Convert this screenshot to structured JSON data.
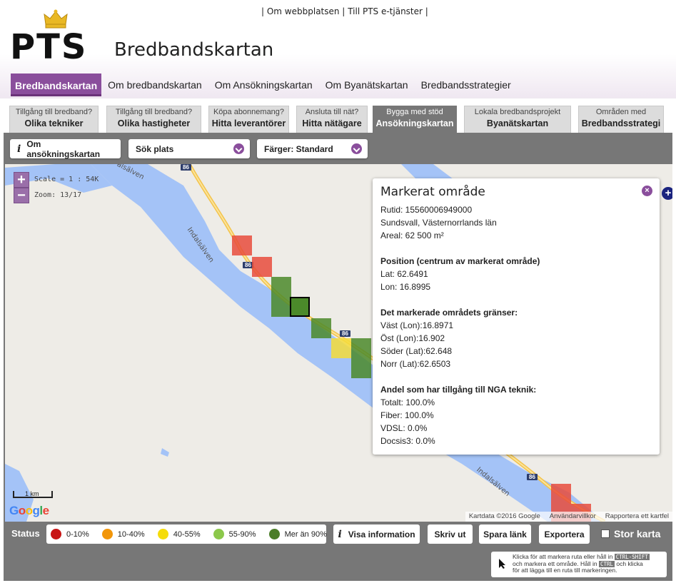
{
  "header": {
    "toplinks": [
      "| Om webbplatsen |",
      "Till PTS e-tjänster |"
    ],
    "logo_text": "PTS",
    "site_title": "Bredbandskartan"
  },
  "mainnav": [
    "Bredbandskartan",
    "Om bredbandskartan",
    "Om Ansökningskartan",
    "Om Byanätskartan",
    "Bredbandsstrategier"
  ],
  "tabs": [
    {
      "top": "Tillgång till bredband?",
      "bottom": "Olika tekniker"
    },
    {
      "top": "Tillgång till bredband?",
      "bottom": "Olika hastigheter"
    },
    {
      "top": "Köpa abonnemang?",
      "bottom": "Hitta leverantörer"
    },
    {
      "top": "Ansluta till nät?",
      "bottom": "Hitta nätägare"
    },
    {
      "top": "Bygga med stöd",
      "bottom": "Ansökningskartan"
    },
    {
      "top": "Lokala bredbandsprojekt",
      "bottom": "Byanätskartan"
    },
    {
      "top": "Områden med",
      "bottom": "Bredbandsstrategi"
    }
  ],
  "controls": {
    "info_label": "Om ansökningskartan",
    "search_label": "Sök plats",
    "colors_label": "Färger: Standard"
  },
  "map": {
    "scale": "Scale = 1 : 54K",
    "zoom": "Zoom: 13/17",
    "river_labels": [
      "alsälven",
      "Indalsälven",
      "Indalsälven"
    ],
    "road_number": "86",
    "scalebar_label": "1 km",
    "google": "Google",
    "attribution": [
      "Kartdata ©2016 Google",
      "Användarvillkor",
      "Rapportera ett kartfel"
    ]
  },
  "popup": {
    "title": "Markerat område",
    "rutid": "Rutid: 15560006949000",
    "location": "Sundsvall, Västernorrlands län",
    "area": "Areal: 62 500 m²",
    "position_heading": "Position (centrum av markerat område)",
    "lat": "Lat: 62.6491",
    "lon": "Lon: 16.8995",
    "bounds_heading": "Det markerade områdets gränser:",
    "west": "Väst (Lon):16.8971",
    "east": "Öst (Lon):16.902",
    "south": "Söder (Lat):62.648",
    "north": "Norr (Lat):62.6503",
    "nga_heading": "Andel som har tillgång till NGA teknik:",
    "total": "Totalt: 100.0%",
    "fiber": "Fiber: 100.0%",
    "vdsl": "VDSL: 0.0%",
    "docsis": "Docsis3: 0.0%"
  },
  "status": {
    "label": "Status",
    "legend": [
      {
        "label": "0-10%",
        "color": "#c81414"
      },
      {
        "label": "10-40%",
        "color": "#f2960a"
      },
      {
        "label": "40-55%",
        "color": "#f5dc0a"
      },
      {
        "label": "55-90%",
        "color": "#8cc84b"
      },
      {
        "label": "Mer än 90%",
        "color": "#4b7d28"
      }
    ]
  },
  "actions": {
    "visa": "Visa information",
    "skriv": "Skriv ut",
    "spara": "Spara länk",
    "exportera": "Exportera",
    "stor_karta": "Stor karta"
  },
  "hint": {
    "line1a": "Klicka för att markera ruta eller håll in",
    "key1": "CTRL-SHIFT",
    "line2a": "och markera ett område. Håll in",
    "key2": "CTRL",
    "line2b": "och klicka",
    "line3": "för att lägga till en ruta till markeringen."
  },
  "colors": {
    "accent": "#8a4e9c",
    "panel": "#777777",
    "water": "#a4c3f7",
    "red": "#e74c3c",
    "green": "#4b8a2a",
    "yellow": "#f5dc3a"
  }
}
